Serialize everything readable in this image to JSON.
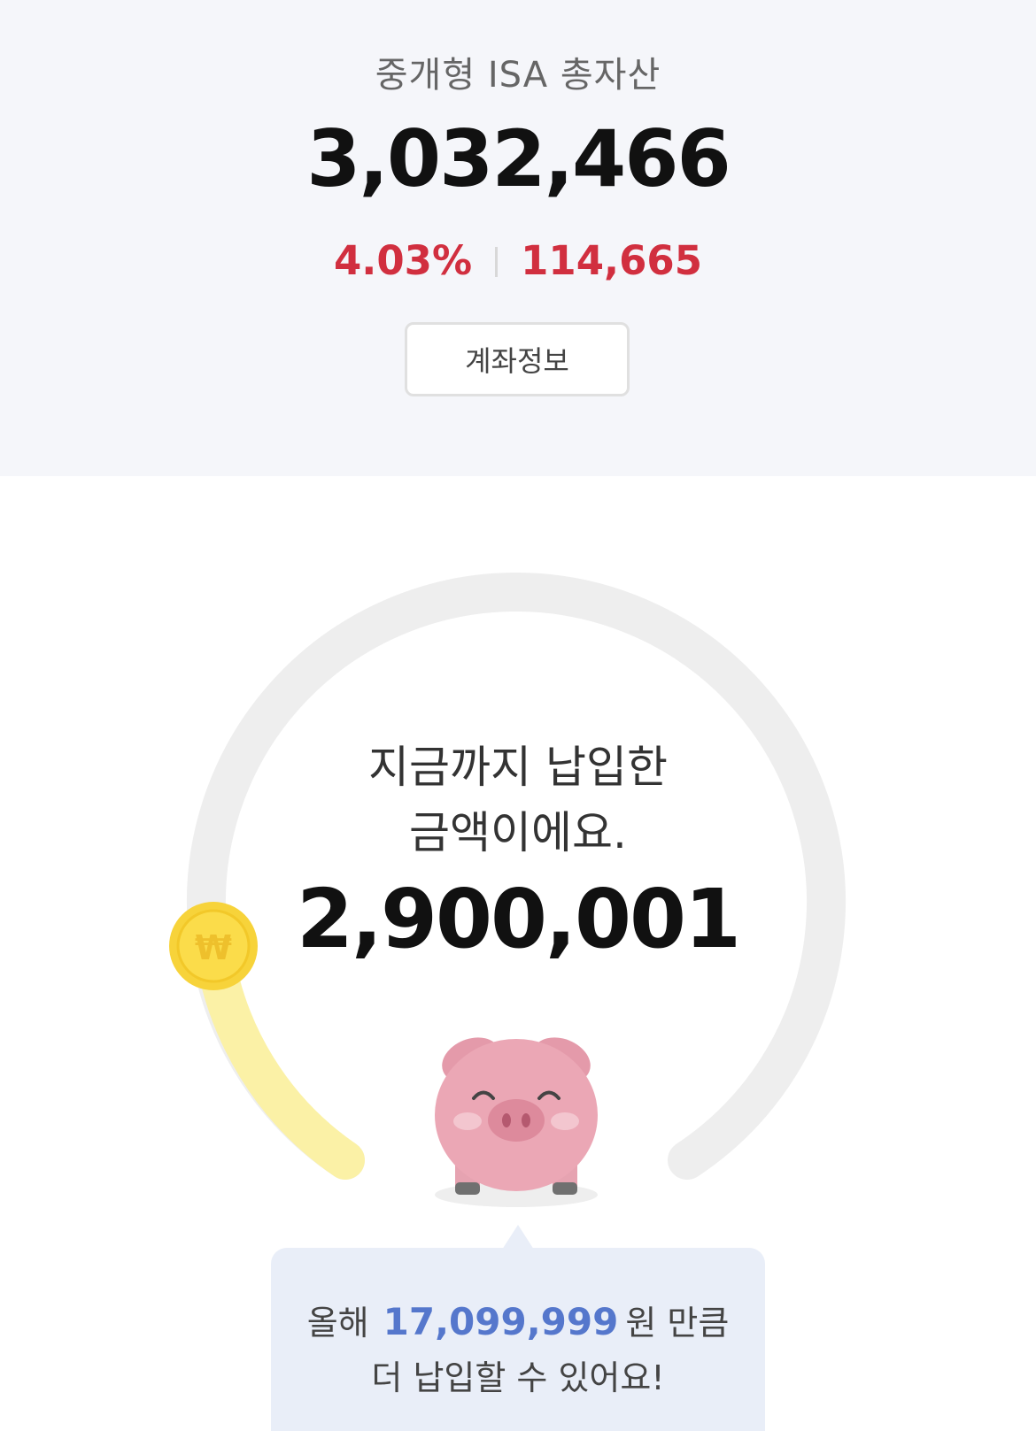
{
  "header": {
    "title": "중개형 ISA 총자산",
    "total_assets": "3,032,466",
    "return_rate": "4.03%",
    "return_amount": "114,665",
    "account_info_button": "계좌정보"
  },
  "gauge": {
    "caption_line1": "지금까지 납입한",
    "caption_line2": "금액이에요.",
    "paid_amount": "2,900,001",
    "coin_symbol": "₩",
    "progress_fraction": 0.146,
    "track_color": "#eeeeee",
    "progress_color": "#fbf1a6",
    "coin_color": "#f7d33a",
    "mascot_icon": "piggy-bank"
  },
  "bubble": {
    "prefix": "올해",
    "remaining_amount": "17,099,999",
    "unit_suffix": "원 만큼",
    "line2": "더 납입할 수 있어요!"
  },
  "colors": {
    "positive_red": "#d12f3f",
    "highlight_blue": "#5577cc",
    "top_background": "#f5f6fa",
    "bubble_background": "#e9eef8"
  }
}
